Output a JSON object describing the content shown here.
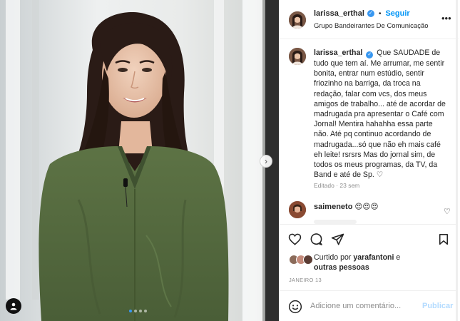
{
  "post": {
    "username": "larissa_erthal",
    "follow_label": "Seguir",
    "separator": "•",
    "location": "Grupo Bandeirantes De Comunicação",
    "more_icon": "more-options-icon",
    "verified_icon": "verified-badge-icon"
  },
  "caption": {
    "username": "larissa_erthal",
    "text": "Que SAUDADE de tudo que tem aí. Me arrumar, me sentir bonita, entrar num estúdio, sentir friozinho na barriga, da troca na redação, falar com vcs, dos meus amigos de trabalho... até de acordar de madrugada pra apresentar o Café com Jornal! Mentira hahahha essa parte não. Até pq continuo acordando de madrugada...só que não eh mais café eh leite! rsrsrs Mas do jornal sim, de todos os meus programas, da TV, da Band e até de Sp. ♡",
    "meta": "Editado · 23 sem"
  },
  "comment": {
    "username": "saimeneto",
    "text": "😍😍😍"
  },
  "actions": {
    "like_icon": "heart-icon",
    "comment_icon": "comment-icon",
    "share_icon": "share-icon",
    "save_icon": "bookmark-icon"
  },
  "likes": {
    "prefix": "Curtido por",
    "user": "yarafantoni",
    "suffix": "e",
    "others": "outras pessoas"
  },
  "date": "JANEIRO 13",
  "add_comment": {
    "placeholder": "Adicione um comentário...",
    "publish_label": "Publicar"
  },
  "carousel": {
    "total_slides": 4,
    "active_slide": 1
  },
  "colors": {
    "accent": "#0095f6",
    "verified": "#3897f0",
    "blouse": "#556b3f",
    "text": "#262626",
    "muted": "#8e8e8e"
  }
}
